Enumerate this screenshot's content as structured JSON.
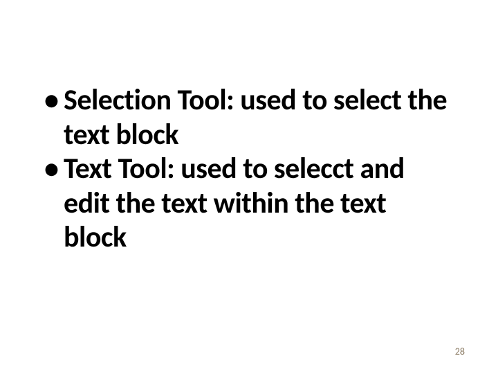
{
  "bullets": [
    {
      "text": "Selection Tool:  used to select the text block"
    },
    {
      "text": "Text Tool:  used to selecct and edit the text within the text block"
    }
  ],
  "bullet_symbol": "•",
  "page_number": "28"
}
